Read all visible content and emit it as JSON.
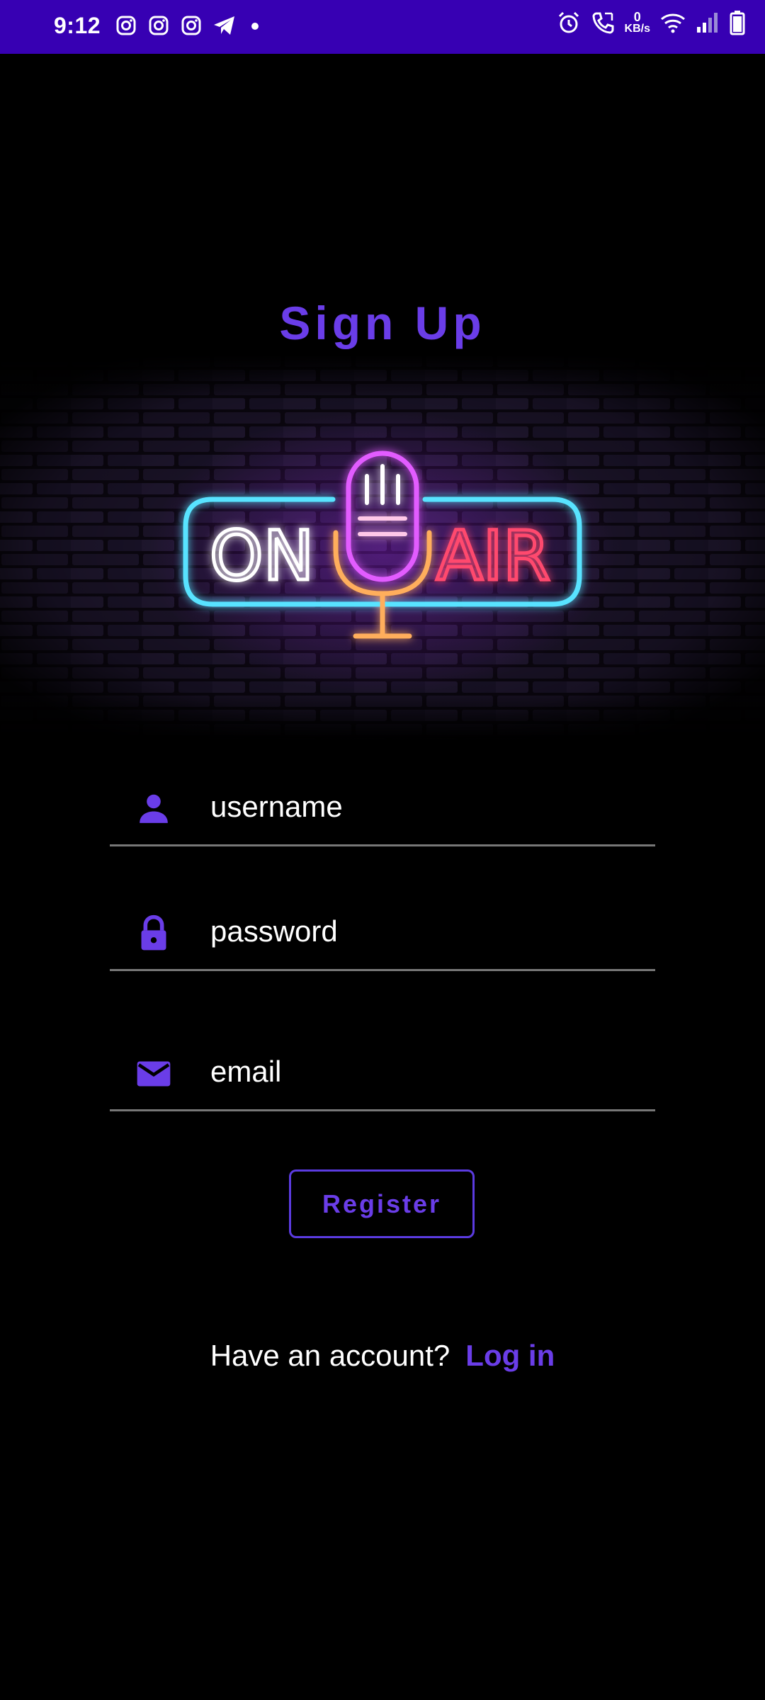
{
  "status_bar": {
    "time": "9:12",
    "left_icons": [
      "instagram-icon",
      "instagram-icon",
      "instagram-icon",
      "telegram-icon",
      "dot-icon"
    ],
    "net_speed_value": "0",
    "net_speed_unit": "KB/s",
    "right_icons": [
      "alarm-icon",
      "call-icon",
      "wifi-icon",
      "signal-icon",
      "battery-icon"
    ]
  },
  "title": "Sign Up",
  "banner": {
    "on_text": "ON",
    "air_text": "AIR"
  },
  "form": {
    "username_placeholder": "username",
    "password_placeholder": "password",
    "email_placeholder": "email",
    "register_label": "Register"
  },
  "footer": {
    "prompt": "Have an account?",
    "login_label": "Log in"
  },
  "colors": {
    "status_bar": "#3700b3",
    "accent": "#6a3de8",
    "background": "#000000"
  }
}
